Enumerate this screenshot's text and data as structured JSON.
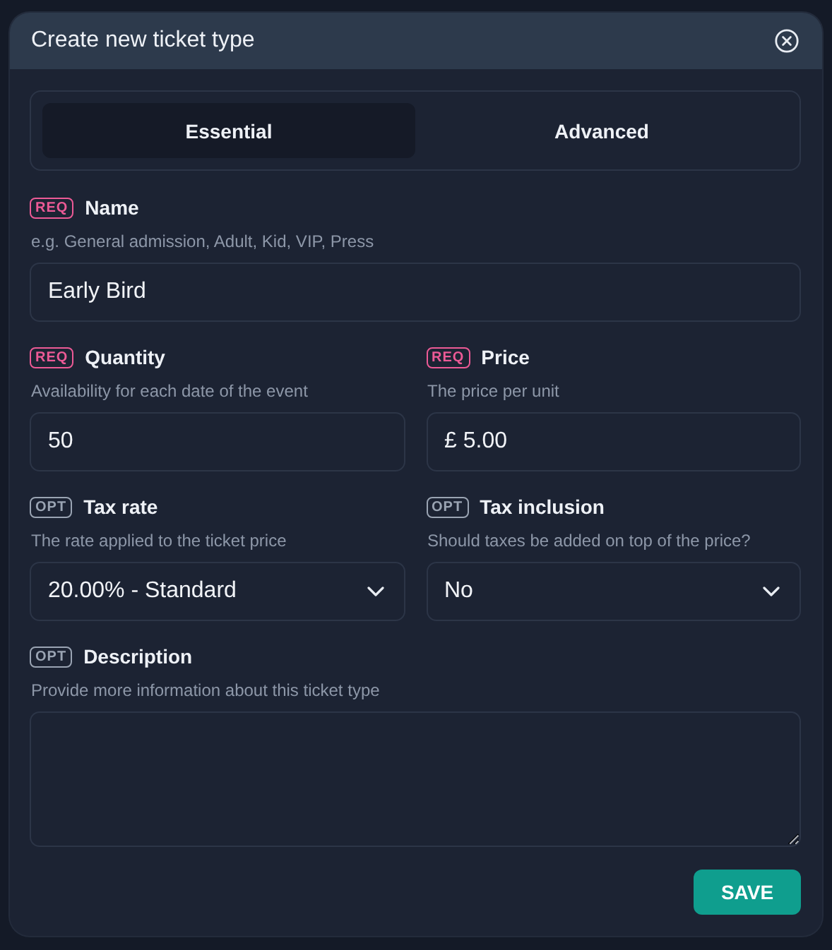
{
  "dialog": {
    "title": "Create new ticket type"
  },
  "tabs": [
    {
      "label": "Essential",
      "selected": true
    },
    {
      "label": "Advanced",
      "selected": false
    }
  ],
  "rows": [
    [
      {
        "kind": "text",
        "badge": "REQ",
        "required": true,
        "label": "Name",
        "hint": "e.g. General admission, Adult, Kid, VIP, Press",
        "value": "Early Bird"
      }
    ],
    [
      {
        "kind": "text",
        "badge": "REQ",
        "required": true,
        "label": "Quantity",
        "hint": "Availability for each date of the event",
        "value": "50"
      },
      {
        "kind": "text",
        "badge": "REQ",
        "required": true,
        "label": "Price",
        "hint": "The price per unit",
        "value": "£ 5.00"
      }
    ],
    [
      {
        "kind": "select",
        "badge": "OPT",
        "required": false,
        "label": "Tax rate",
        "hint": "The rate applied to the ticket price",
        "value": "20.00% - Standard"
      },
      {
        "kind": "select",
        "badge": "OPT",
        "required": false,
        "label": "Tax inclusion",
        "hint": "Should taxes be added on top of the price?",
        "value": "No"
      }
    ],
    [
      {
        "kind": "textarea",
        "badge": "OPT",
        "required": false,
        "label": "Description",
        "hint": "Provide more information about this ticket type"
      }
    ]
  ],
  "save_button": "SAVE"
}
